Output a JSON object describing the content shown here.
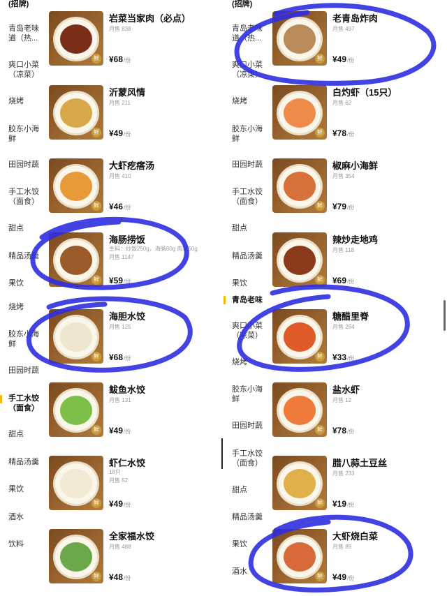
{
  "left": {
    "header_label": "(招牌)",
    "categories": [
      {
        "label": "青岛老味道（热...",
        "active": false
      },
      {
        "label": "爽口小菜（凉菜）",
        "active": false
      },
      {
        "label": "烧烤",
        "active": false
      },
      {
        "label": "胶东小海鲜",
        "active": false
      },
      {
        "label": "田园时蔬",
        "active": false
      },
      {
        "label": "手工水饺（面食）",
        "active": false
      },
      {
        "label": "甜点",
        "active": false
      },
      {
        "label": "精品汤羹",
        "active": false
      },
      {
        "label": "果饮",
        "active": false
      },
      {
        "label": "烧烤",
        "active": false
      },
      {
        "label": "胶东小海鲜",
        "active": false
      },
      {
        "label": "田园时蔬",
        "active": false
      },
      {
        "label": "手工水饺（面食）",
        "active": true
      },
      {
        "label": "甜点",
        "active": false
      },
      {
        "label": "精品汤羹",
        "active": false
      },
      {
        "label": "果饮",
        "active": false
      },
      {
        "label": "酒水",
        "active": false
      },
      {
        "label": "饮料",
        "active": false
      }
    ],
    "items": [
      {
        "name": "岩菜当家肉（必点）",
        "desc": "",
        "sales": "月售 838",
        "price": "¥68",
        "unit": "/份",
        "food_color": "#7a2e1a"
      },
      {
        "name": "沂蒙风情",
        "desc": "",
        "sales": "月售 211",
        "price": "¥49",
        "unit": "/份",
        "food_color": "#d9a84a"
      },
      {
        "name": "大虾疙瘩汤",
        "desc": "",
        "sales": "月售 410",
        "price": "¥46",
        "unit": "/份",
        "food_color": "#e89a3a"
      },
      {
        "name": "海肠捞饭",
        "desc": "主料：炒饭250g，海肠60g 肉末50g",
        "sales": "月售 1147",
        "price": "¥59",
        "unit": "/份",
        "food_color": "#9a5a2a"
      },
      {
        "name": "海胆水饺",
        "desc": "",
        "sales": "月售 125",
        "price": "¥68",
        "unit": "/份",
        "food_color": "#efe6d0"
      },
      {
        "name": "鲅鱼水饺",
        "desc": "",
        "sales": "月售 131",
        "price": "¥49",
        "unit": "/份",
        "food_color": "#7cc04a"
      },
      {
        "name": "虾仁水饺",
        "desc": "18只",
        "sales": "月售 52",
        "price": "¥49",
        "unit": "/份",
        "food_color": "#f3ead6"
      },
      {
        "name": "全家福水饺",
        "desc": "",
        "sales": "月售 488",
        "price": "¥48",
        "unit": "/份",
        "food_color": "#6aa84a"
      }
    ]
  },
  "right": {
    "header_label": "(招牌)",
    "categories": [
      {
        "label": "青岛老味道（热...",
        "active": false
      },
      {
        "label": "爽口小菜（凉菜）",
        "active": false
      },
      {
        "label": "烧烤",
        "active": false
      },
      {
        "label": "胶东小海鲜",
        "active": false
      },
      {
        "label": "田园时蔬",
        "active": false
      },
      {
        "label": "手工水饺（面食）",
        "active": false
      },
      {
        "label": "甜点",
        "active": false
      },
      {
        "label": "精品汤羹",
        "active": false
      },
      {
        "label": "果饮",
        "active": false
      },
      {
        "label": "青岛老味道（热...",
        "active": true
      },
      {
        "label": "爽口小菜（凉菜）",
        "active": false
      },
      {
        "label": "烧烤",
        "active": false
      },
      {
        "label": "胶东小海鲜",
        "active": false
      },
      {
        "label": "田园时蔬",
        "active": false
      },
      {
        "label": "手工水饺（面食）",
        "active": false
      },
      {
        "label": "甜点",
        "active": false
      },
      {
        "label": "精品汤羹",
        "active": false
      },
      {
        "label": "果饮",
        "active": false
      },
      {
        "label": "酒水",
        "active": false
      }
    ],
    "items": [
      {
        "name": "老青岛炸肉",
        "desc": "",
        "sales": "月售 497",
        "price": "¥49",
        "unit": "/份",
        "food_color": "#b98a5a"
      },
      {
        "name": "白灼虾（15只）",
        "desc": "",
        "sales": "月售 62",
        "price": "¥78",
        "unit": "/份",
        "food_color": "#f08a4a"
      },
      {
        "name": "椒麻小海鲜",
        "desc": "",
        "sales": "月售 354",
        "price": "¥79",
        "unit": "/份",
        "food_color": "#d8703a"
      },
      {
        "name": "辣炒走地鸡",
        "desc": "",
        "sales": "月售 118",
        "price": "¥69",
        "unit": "/份",
        "food_color": "#8a3a1a"
      },
      {
        "name": "糖醋里脊",
        "desc": "",
        "sales": "月售 294",
        "price": "¥33",
        "unit": "/份",
        "food_color": "#e05a2a"
      },
      {
        "name": "盐水虾",
        "desc": "",
        "sales": "月售 12",
        "price": "¥78",
        "unit": "/份",
        "food_color": "#f07a3a"
      },
      {
        "name": "腊八蒜土豆丝",
        "desc": "",
        "sales": "月售 233",
        "price": "¥19",
        "unit": "/份",
        "food_color": "#e0b04a"
      },
      {
        "name": "大虾烧白菜",
        "desc": "",
        "sales": "月售 89",
        "price": "¥49",
        "unit": "/份",
        "food_color": "#d86a3a"
      }
    ]
  }
}
